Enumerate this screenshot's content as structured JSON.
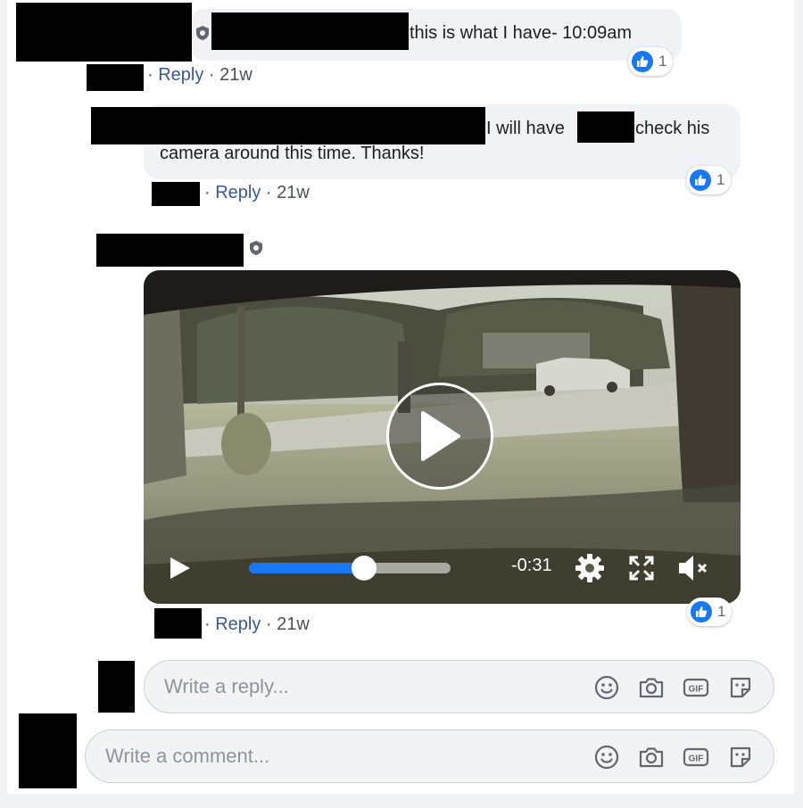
{
  "comments": [
    {
      "text_1": "this is what I have- 10:09am",
      "reply_label": "Reply",
      "time": "21w",
      "likes": "1"
    },
    {
      "text_1": "I will have",
      "text_2": "check his",
      "text_3": "camera around this time. Thanks!",
      "reply_label": "Reply",
      "time": "21w",
      "likes": "1"
    },
    {
      "reply_label": "Reply",
      "time": "21w",
      "likes": "1"
    }
  ],
  "video": {
    "remaining_time": "-0:31",
    "progress_fraction": 0.57,
    "buffered_fraction": 1.0,
    "controls": [
      "play-icon",
      "settings-gear-icon",
      "fullscreen-icon",
      "muted-speaker-icon"
    ]
  },
  "reply_input": {
    "placeholder": "Write a reply..."
  },
  "comment_input": {
    "placeholder": "Write a comment..."
  },
  "composer_icons": [
    "emoji-icon",
    "camera-icon",
    "gif-icon",
    "sticker-icon"
  ],
  "colors": {
    "link": "#385898",
    "like_blue": "#1877f2",
    "progress_blue": "#1877f2",
    "bubble": "#f0f2f5"
  }
}
